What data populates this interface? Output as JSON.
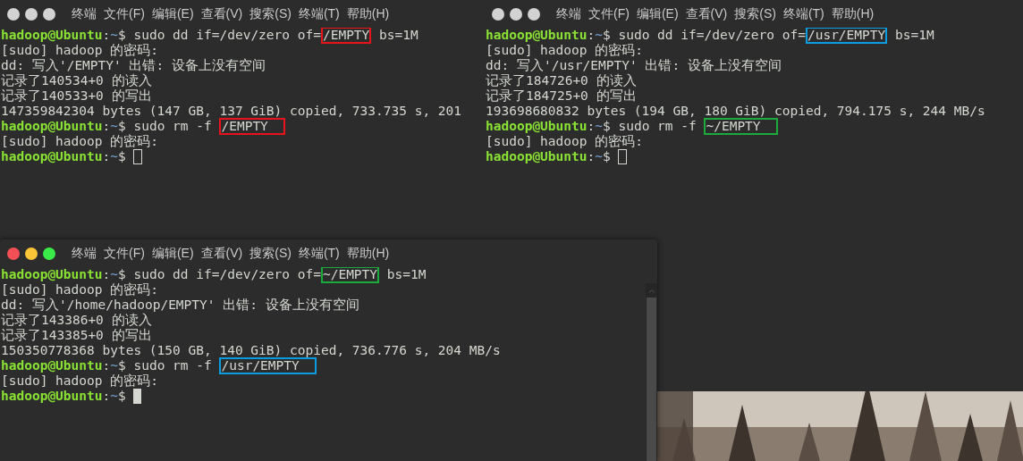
{
  "windows": [
    {
      "focused": false,
      "menu": [
        "终端",
        "文件(F)",
        "编辑(E)",
        "查看(V)",
        "搜索(S)",
        "终端(T)",
        "帮助(H)"
      ],
      "lines": [
        {
          "kind": "prompt",
          "user": "hadoop@Ubuntu",
          "colon": ":",
          "path": "~",
          "sign": "$",
          "command": [
            {
              "text": "sudo dd if=/dev/zero of="
            },
            {
              "text": "/EMPTY",
              "color": "#e8131b"
            },
            {
              "text": " bs=1M"
            }
          ]
        },
        {
          "kind": "output",
          "text": "[sudo] hadoop 的密码:"
        },
        {
          "kind": "output",
          "text": "dd: 写入'/EMPTY' 出错: 设备上没有空间"
        },
        {
          "kind": "output",
          "text": "记录了140534+0 的读入"
        },
        {
          "kind": "output",
          "text": "记录了140533+0 的写出"
        },
        {
          "kind": "output",
          "text": "147359842304 bytes (147 GB, 137 GiB) copied, 733.735 s, 201"
        },
        {
          "kind": "prompt",
          "user": "hadoop@Ubuntu",
          "colon": ":",
          "path": "~",
          "sign": "$",
          "command": [
            {
              "text": "sudo rm -f "
            },
            {
              "text": "/EMPTY  ",
              "color": "#e8131b"
            }
          ]
        },
        {
          "kind": "output",
          "text": "[sudo] hadoop 的密码:"
        },
        {
          "kind": "prompt",
          "user": "hadoop@Ubuntu",
          "colon": ":",
          "path": "~",
          "sign": "$",
          "cursor": true
        }
      ]
    },
    {
      "focused": false,
      "menu": [
        "终端",
        "文件(F)",
        "编辑(E)",
        "查看(V)",
        "搜索(S)",
        "终端(T)",
        "帮助(H)"
      ],
      "lines": [
        {
          "kind": "prompt",
          "user": "hadoop@Ubuntu",
          "colon": ":",
          "path": "~",
          "sign": "$",
          "command": [
            {
              "text": "sudo dd if=/dev/zero of="
            },
            {
              "text": "/usr/EMPTY",
              "color": "#0a9ce0"
            },
            {
              "text": " bs=1M"
            }
          ]
        },
        {
          "kind": "output",
          "text": "[sudo] hadoop 的密码:"
        },
        {
          "kind": "output",
          "text": "dd: 写入'/usr/EMPTY' 出错: 设备上没有空间"
        },
        {
          "kind": "output",
          "text": "记录了184726+0 的读入"
        },
        {
          "kind": "output",
          "text": "记录了184725+0 的写出"
        },
        {
          "kind": "output",
          "text": "193698680832 bytes (194 GB, 180 GiB) copied, 794.175 s, 244 MB/s"
        },
        {
          "kind": "prompt",
          "user": "hadoop@Ubuntu",
          "colon": ":",
          "path": "~",
          "sign": "$",
          "command": [
            {
              "text": "sudo rm -f "
            },
            {
              "text": "~/EMPTY  ",
              "color": "#1aab3c"
            }
          ]
        },
        {
          "kind": "output",
          "text": "[sudo] hadoop 的密码:"
        },
        {
          "kind": "prompt",
          "user": "hadoop@Ubuntu",
          "colon": ":",
          "path": "~",
          "sign": "$",
          "cursor": true
        }
      ]
    },
    {
      "focused": true,
      "menu": [
        "终端",
        "文件(F)",
        "编辑(E)",
        "查看(V)",
        "搜索(S)",
        "终端(T)",
        "帮助(H)"
      ],
      "lines": [
        {
          "kind": "prompt",
          "user": "hadoop@Ubuntu",
          "colon": ":",
          "path": "~",
          "sign": "$",
          "command": [
            {
              "text": "sudo dd if=/dev/zero of="
            },
            {
              "text": "~/EMPTY",
              "color": "#1aab3c"
            },
            {
              "text": " bs=1M"
            }
          ]
        },
        {
          "kind": "output",
          "text": "[sudo] hadoop 的密码:"
        },
        {
          "kind": "output",
          "text": "dd: 写入'/home/hadoop/EMPTY' 出错: 设备上没有空间"
        },
        {
          "kind": "output",
          "text": "记录了143386+0 的读入"
        },
        {
          "kind": "output",
          "text": "记录了143385+0 的写出"
        },
        {
          "kind": "output",
          "text": "150350778368 bytes (150 GB, 140 GiB) copied, 736.776 s, 204 MB/s"
        },
        {
          "kind": "prompt",
          "user": "hadoop@Ubuntu",
          "colon": ":",
          "path": "~",
          "sign": "$",
          "command": [
            {
              "text": "sudo rm -f "
            },
            {
              "text": "/usr/EMPTY  ",
              "color": "#0a9ce0"
            }
          ]
        },
        {
          "kind": "output",
          "text": "[sudo] hadoop 的密码:"
        },
        {
          "kind": "prompt",
          "user": "hadoop@Ubuntu",
          "colon": ":",
          "path": "~",
          "sign": "$",
          "cursor": true
        }
      ]
    }
  ]
}
